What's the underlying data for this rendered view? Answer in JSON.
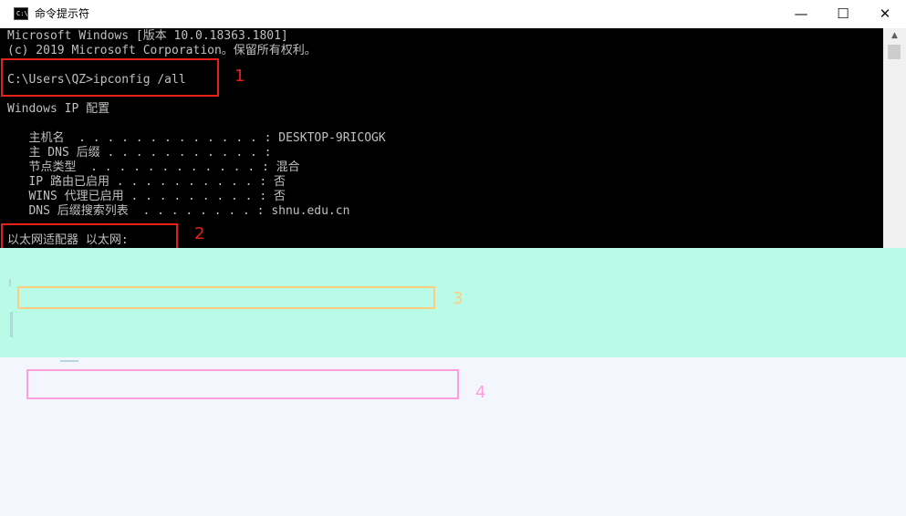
{
  "window": {
    "title": "命令提示符",
    "app_icon_glyph": "C:\\",
    "controls": {
      "minimize": "—",
      "maximize": "☐",
      "close": "✕"
    }
  },
  "console": {
    "lines": [
      "Microsoft Windows [版本 10.0.18363.1801]",
      "(c) 2019 Microsoft Corporation。保留所有权利。",
      "",
      "C:\\Users\\QZ>ipconfig /all",
      "",
      "Windows IP 配置",
      "",
      "   主机名  . . . . . . . . . . . . . : DESKTOP-9RICOGK",
      "   主 DNS 后缀 . . . . . . . . . . . :",
      "   节点类型  . . . . . . . . . . . . : 混合",
      "   IP 路由已启用 . . . . . . . . . . : 否",
      "   WINS 代理已启用 . . . . . . . . . : 否",
      "   DNS 后缀搜索列表  . . . . . . . . : shnu.edu.cn",
      "",
      "以太网适配器 以太网:"
    ]
  },
  "annotations": [
    {
      "number": "1",
      "color": "#e8201a"
    },
    {
      "number": "2",
      "color": "#e8201a"
    },
    {
      "number": "3",
      "color": "#ffcd7f"
    },
    {
      "number": "4",
      "color": "#ff9edc"
    }
  ],
  "colors": {
    "console_bg": "#000000",
    "console_text": "#c0c0c0",
    "mint_band": "#b9fbe7",
    "lavender_band": "#f4f6fd"
  }
}
